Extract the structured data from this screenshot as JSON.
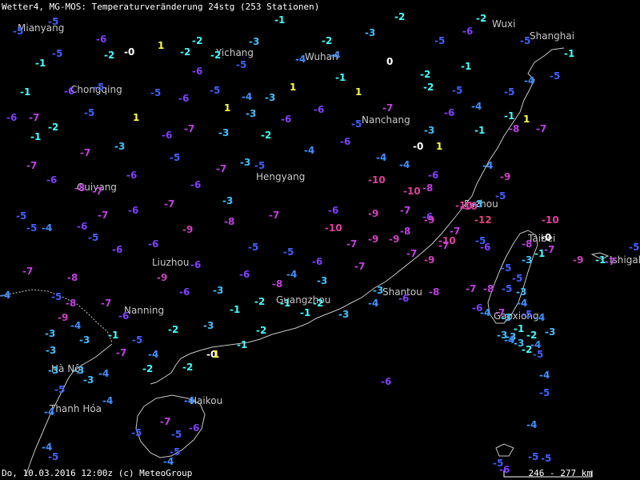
{
  "header": "Wetter4, MG-MOS: Temperaturveränderung 24stg (253 Stationen)",
  "footer": "Do, 10.03.2016 12:00z (c) MeteoGroup",
  "scale_label": "246 - 277 km",
  "colors": {
    "background": "#000000",
    "coastline": "#c8c8c8",
    "city_label": "#c8c8c8",
    "val_pos2": "#ffa040",
    "val_pos1": "#ffff40",
    "val_0": "#ffffff",
    "val_m1": "#40ffff",
    "val_m2": "#40ffff",
    "val_m3": "#40c0ff",
    "val_m4": "#4090ff",
    "val_m5": "#4060ff",
    "val_m6": "#8040ff",
    "val_m7": "#c040e0",
    "val_m8": "#c040e0",
    "val_m9": "#d040c0",
    "val_m10": "#e040a0",
    "val_m12": "#e04080"
  },
  "cities": [
    "Mianyang",
    "Yichang",
    "Wuhan",
    "Wuxi",
    "Shanghai",
    "Chongqing",
    "Nanchang",
    "Hengyang",
    "Guiyang",
    "Fuzhou",
    "Taibei",
    "Ishigaki",
    "Liuzhou",
    "Nanning",
    "Guangzhou",
    "Shantou",
    "Gaoxiong",
    "Hà Nội",
    "Haikou",
    "Thanh Hóa"
  ],
  "values": [
    "-5",
    "-1",
    "-2",
    "-2",
    "-5",
    "-6",
    "-2",
    "-2",
    "-3",
    "-5",
    "-6",
    "-5",
    "-5",
    "-2",
    "-0",
    "1",
    "-2",
    "-2",
    "-3",
    "-6",
    "-5",
    "-4",
    "-4",
    "0",
    "-1",
    "-1",
    "-1",
    "-5",
    "-6",
    "-5",
    "-6",
    "-5",
    "-4",
    "-3",
    "1",
    "1",
    "-1",
    "-1",
    "-2",
    "-2",
    "-5",
    "-5",
    "-4",
    "-5",
    "-6",
    "-7",
    "-5",
    "1",
    "1",
    "-3",
    "-6",
    "-7",
    "-6",
    "-4",
    "-1",
    "1",
    "-1",
    "-2",
    "-3",
    "-6",
    "-7",
    "-6",
    "-5",
    "-3",
    "-1",
    "-8",
    "-7",
    "-7",
    "-5",
    "-3",
    "-4",
    "1",
    "-0",
    "-2",
    "-3",
    "-5",
    "-7",
    "-6",
    "-4",
    "-4",
    "-6",
    "-7",
    "-6",
    "-8",
    "-7",
    "-6",
    "-6",
    "-3",
    "-4",
    "-9",
    "-10",
    "-10",
    "-8",
    "-10",
    "-3",
    "-5",
    "-5",
    "-5",
    "-4",
    "-6",
    "-5",
    "-7",
    "-6",
    "-7",
    "-6",
    "-9",
    "-7",
    "-6",
    "-10",
    "-12",
    "-10",
    "-9",
    "-8",
    "-7",
    "-10",
    "-7",
    "-9",
    "-9",
    "-8",
    "-9",
    "-10",
    "-7",
    "-6",
    "-7",
    "-8",
    "-6",
    "-6",
    "-6",
    "-5",
    "-5",
    "-6",
    "-7",
    "-7",
    "-9",
    "-7",
    "-5",
    "-5",
    "-5",
    "-8",
    "-7",
    "-9",
    "-7",
    "-5",
    "-4",
    "-5",
    "-8",
    "-7",
    "-6",
    "-9",
    "-9",
    "-6",
    "-3",
    "-6",
    "-8",
    "-4",
    "-3",
    "-3",
    "-6",
    "-8",
    "-7",
    "-8",
    "-5",
    "-3",
    "-6",
    "-7",
    "-4",
    "-5",
    "-4",
    "-4",
    "-3",
    "-3",
    "-3",
    "-7",
    "-5",
    "-4",
    "-2",
    "-3",
    "-1",
    "-2",
    "-1",
    "-1",
    "-2",
    "-3",
    "-4",
    "-4",
    "-3",
    "-1",
    "-2",
    "-0",
    "1",
    "-2",
    "-1",
    "-2",
    "-2",
    "-1",
    "-3",
    "-4",
    "-3",
    "-3",
    "-5",
    "-4",
    "-4",
    "-4",
    "-6",
    "-7",
    "-5",
    "-5",
    "-6",
    "-5",
    "-4",
    "-4",
    "-5",
    "-5",
    "-6",
    "-5",
    "-5",
    "-4",
    "-5",
    "-4",
    "-3",
    "-3",
    "-3",
    "-4",
    "-3",
    "-1",
    "-0",
    "-1",
    "-2",
    "-3",
    "-4",
    "-5"
  ]
}
